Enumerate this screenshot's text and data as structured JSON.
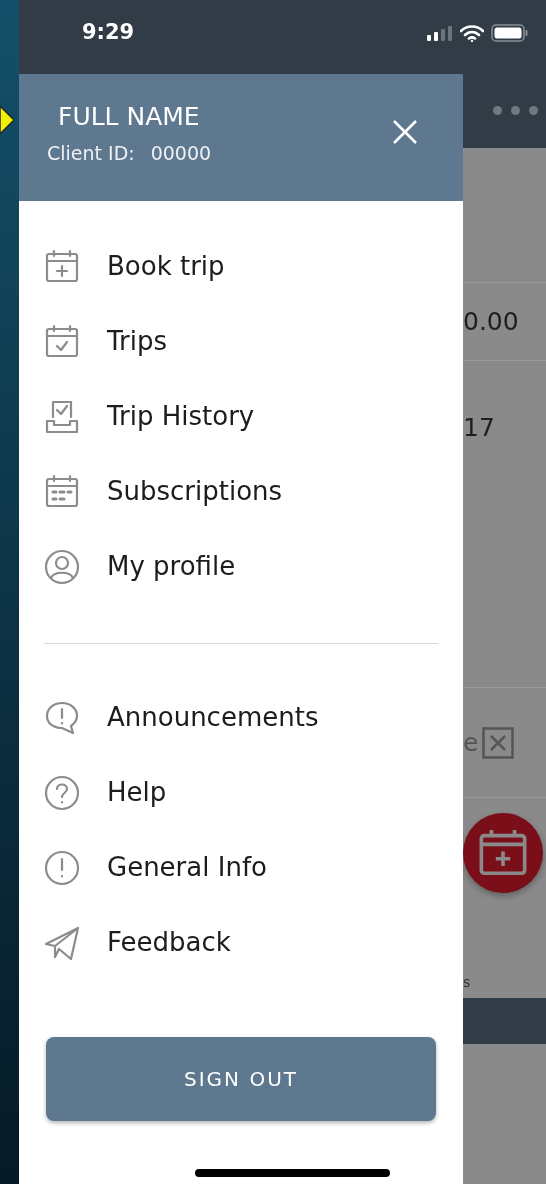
{
  "status_bar": {
    "time": "9:29"
  },
  "drawer": {
    "user_name": "FULL NAME",
    "client_id_label": "Client ID:",
    "client_id": "00000",
    "menu_groups": [
      [
        {
          "kind": "calendar-plus",
          "label": "Book trip"
        },
        {
          "kind": "calendar-check",
          "label": "Trips"
        },
        {
          "kind": "tray-check",
          "label": "Trip History"
        },
        {
          "kind": "calendar-grid",
          "label": "Subscriptions"
        },
        {
          "kind": "person",
          "label": "My profile"
        }
      ],
      [
        {
          "kind": "speech-alert",
          "label": "Announcements"
        },
        {
          "kind": "question",
          "label": "Help"
        },
        {
          "kind": "alert",
          "label": "General Info"
        },
        {
          "kind": "paper-plane",
          "label": "Feedback"
        }
      ]
    ],
    "sign_out": "SIGN OUT"
  },
  "background": {
    "amount": "0.00",
    "number": "17",
    "label_fragment": "e",
    "footer_fragment": "s"
  }
}
